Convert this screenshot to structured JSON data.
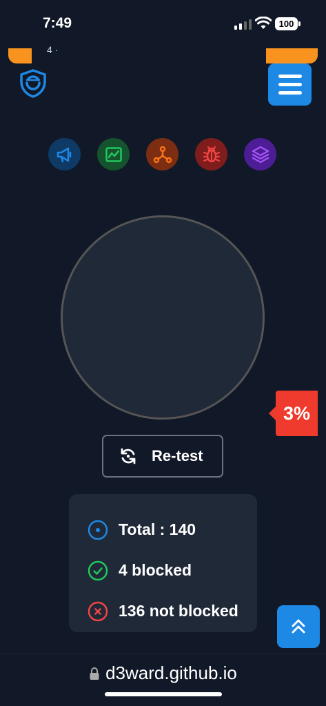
{
  "status_bar": {
    "time": "7:49",
    "battery": "100"
  },
  "header": {
    "partial_text": "4 ·",
    "logo_icon": "shield-logo-icon",
    "menu_icon": "hamburger-menu-icon"
  },
  "category_icons": [
    {
      "name": "megaphone-icon",
      "color": "#1e88e5",
      "bg": "#0f3a66"
    },
    {
      "name": "chart-icon",
      "color": "#22c55e",
      "bg": "#14532d"
    },
    {
      "name": "network-icon",
      "color": "#f97316",
      "bg": "#7c2d12"
    },
    {
      "name": "bug-icon",
      "color": "#ef4444",
      "bg": "#7f1d1d"
    },
    {
      "name": "layers-icon",
      "color": "#a855f7",
      "bg": "#4c1d95"
    }
  ],
  "gauge": {
    "percent_value": 0.03,
    "fill_color": "#ef3b2d"
  },
  "percent_label": "3%",
  "retest": {
    "label": "Re-test",
    "icon": "refresh-icon"
  },
  "stats": {
    "total": "Total : 140",
    "blocked": "4 blocked",
    "not_blocked": "136 not blocked"
  },
  "address_bar": {
    "url": "d3ward.github.io"
  },
  "colors": {
    "accent": "#1e88e5",
    "success": "#22c55e",
    "danger": "#ef3b2d",
    "background": "#111827"
  }
}
